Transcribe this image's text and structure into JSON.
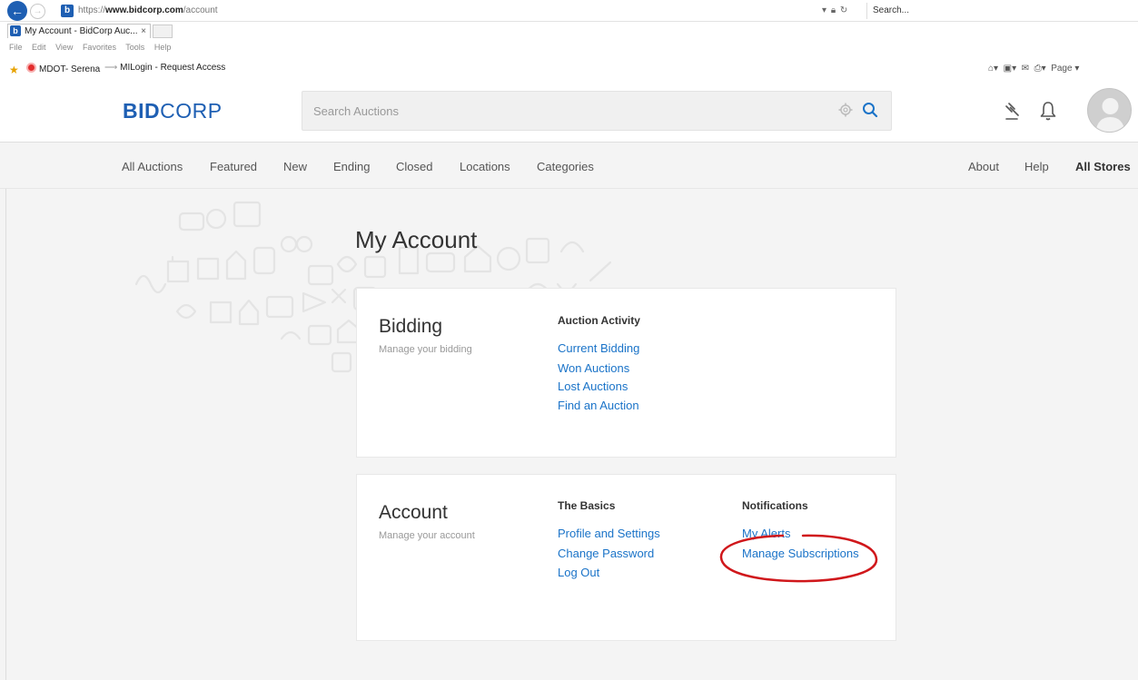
{
  "browser": {
    "url_scheme": "https://",
    "url_host": "www.bidcorp.com",
    "url_path": "/account",
    "search_placeholder": "Search...",
    "tab_title": "My Account - BidCorp Auc...",
    "tab_close": "×",
    "menu": [
      "File",
      "Edit",
      "View",
      "Favorites",
      "Tools",
      "Help"
    ],
    "favorites": [
      "MDOT- Serena",
      "MILogin - Request Access"
    ],
    "page_menu": "Page ▾",
    "favicon_letter": "b"
  },
  "header": {
    "logo_bold": "BID",
    "logo_rest": "CORP",
    "search_placeholder": "Search Auctions"
  },
  "nav": {
    "left": [
      "All Auctions",
      "Featured",
      "New",
      "Ending",
      "Closed",
      "Locations",
      "Categories"
    ],
    "right": [
      "About",
      "Help",
      "All Stores"
    ]
  },
  "page": {
    "title": "My Account"
  },
  "bidding": {
    "title": "Bidding",
    "subtitle": "Manage your bidding",
    "activity_heading": "Auction Activity",
    "links": [
      "Current Bidding",
      "Won Auctions",
      "Lost Auctions",
      "Find an Auction"
    ]
  },
  "account": {
    "title": "Account",
    "subtitle": "Manage your account",
    "basics_heading": "The Basics",
    "basics_links": [
      "Profile and Settings",
      "Change Password",
      "Log Out"
    ],
    "notifications_heading": "Notifications",
    "notifications_links": [
      "My Alerts",
      "Manage Subscriptions"
    ]
  },
  "colors": {
    "brand": "#1e5fb3",
    "link": "#1a73c8",
    "annotation": "#d0171b"
  }
}
